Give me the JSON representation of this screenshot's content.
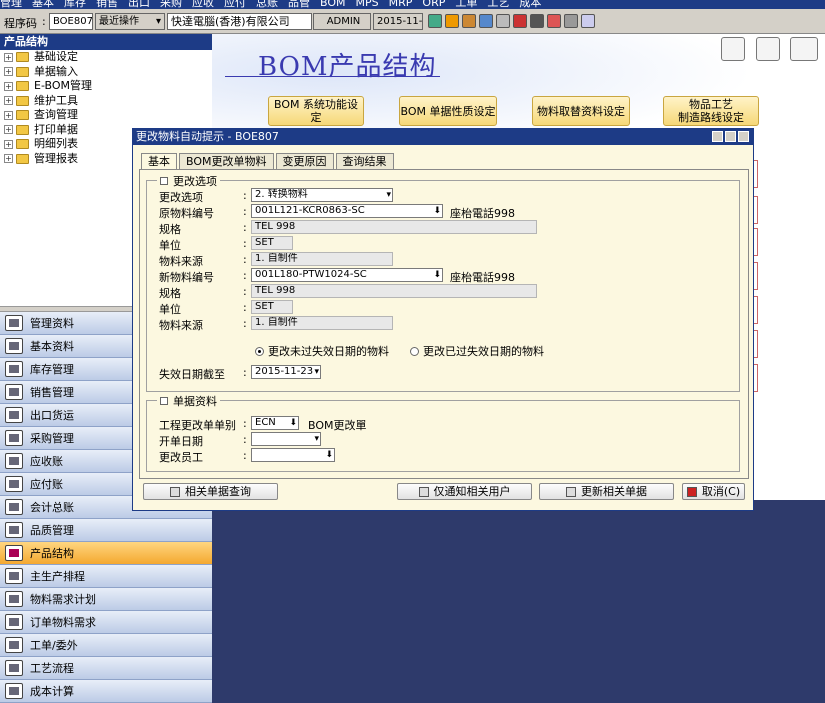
{
  "menu": [
    "管理",
    "基本",
    "库存",
    "销售",
    "出口",
    "采购",
    "应收",
    "应付",
    "总账",
    "品管",
    "BOM",
    "MPS",
    "MRP",
    "ORP",
    "工单",
    "工艺",
    "成本"
  ],
  "toolbar": {
    "prog_label": "程序码",
    "prog_code": "BOE807",
    "recent_ops": "最近操作",
    "company": "快達電腦(香港)有限公司",
    "user": "ADMIN",
    "date": "2015-11-23"
  },
  "left_panel": {
    "title": "产品结构",
    "tree": [
      "基础设定",
      "单据输入",
      "E-BOM管理",
      "维护工具",
      "查询管理",
      "打印单据",
      "明细列表",
      "管理报表"
    ]
  },
  "nav": [
    "管理资料",
    "基本资料",
    "库存管理",
    "销售管理",
    "出口货运",
    "采购管理",
    "应收账",
    "应付账",
    "会计总账",
    "品质管理",
    "产品结构",
    "主生产排程",
    "物料需求计划",
    "订单物料需求",
    "工单/委外",
    "工艺流程",
    "成本计算"
  ],
  "nav_active": "产品结构",
  "main": {
    "title": "BOM产品结构",
    "buttons": [
      "BOM 系统功能设定",
      "BOM 单据性质设定",
      "物料取替资料设定",
      "物品工艺\n制造路线设定"
    ]
  },
  "dialog": {
    "title": "更改物料自动提示 - BOE807",
    "tabs": [
      "基本",
      "BOM更改单物料",
      "变更原因",
      "查询结果"
    ],
    "group1_title": "更改选项",
    "fields": {
      "change_option_label": "更改选项",
      "change_option_value": "2. 转换物料",
      "orig_item_label": "原物料编号",
      "orig_item_value": "001L121-KCR0863-SC",
      "orig_item_desc": "座枱電話998",
      "spec1_label": "规格",
      "spec1_value": "TEL 998",
      "unit1_label": "单位",
      "unit1_value": "SET",
      "source1_label": "物料来源",
      "source1_value": "1. 自制件",
      "new_item_label": "新物料编号",
      "new_item_value": "001L180-PTW1024-SC",
      "new_item_desc": "座枱電話998",
      "spec2_label": "规格",
      "spec2_value": "TEL 998",
      "unit2_label": "单位",
      "unit2_value": "SET",
      "source2_label": "物料来源",
      "source2_value": "1. 自制件",
      "radio1": "更改未过失效日期的物料",
      "radio2": "更改已过失效日期的物料",
      "expire_label": "失效日期截至",
      "expire_value": "2015-11-23"
    },
    "group2_title": "单据资料",
    "doc": {
      "ecn_label": "工程更改单单别",
      "ecn_value": "ECN",
      "ecn_desc": "BOM更改單",
      "open_date_label": "开单日期",
      "open_date_value": "",
      "changer_label": "更改员工",
      "changer_value": ""
    },
    "buttons": {
      "query": "相关单据查询",
      "notify": "仅通知相关用户",
      "update": "更新相关单据",
      "cancel": "取消(C)"
    }
  }
}
